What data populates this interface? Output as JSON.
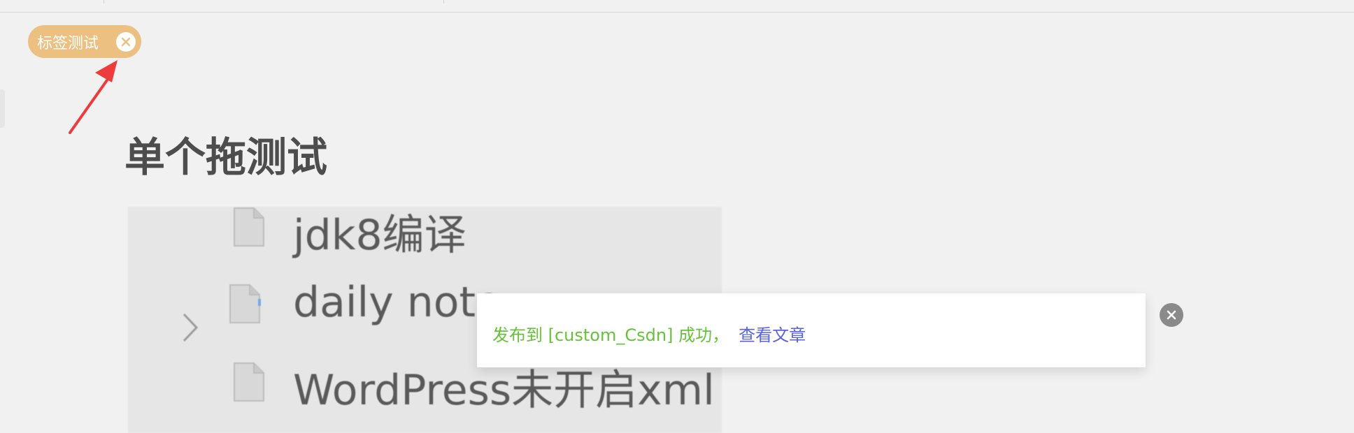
{
  "tag": {
    "label": "标签测试",
    "color": "#ecc080"
  },
  "heading": "单个拖测试",
  "file_tree": {
    "items": [
      {
        "label": "jdk8编译",
        "icon": "document-icon"
      },
      {
        "label": "daily note",
        "icon": "document-icon",
        "expandable": true
      },
      {
        "label": "WordPress未开启xml",
        "icon": "document-icon"
      }
    ]
  },
  "toast": {
    "message": "发布到 [custom_Csdn] 成功，",
    "link_text": "查看文章",
    "success_color": "#67c23a",
    "link_color": "#5b62e0"
  },
  "annotation": {
    "arrow_color": "#ee3b3b"
  }
}
